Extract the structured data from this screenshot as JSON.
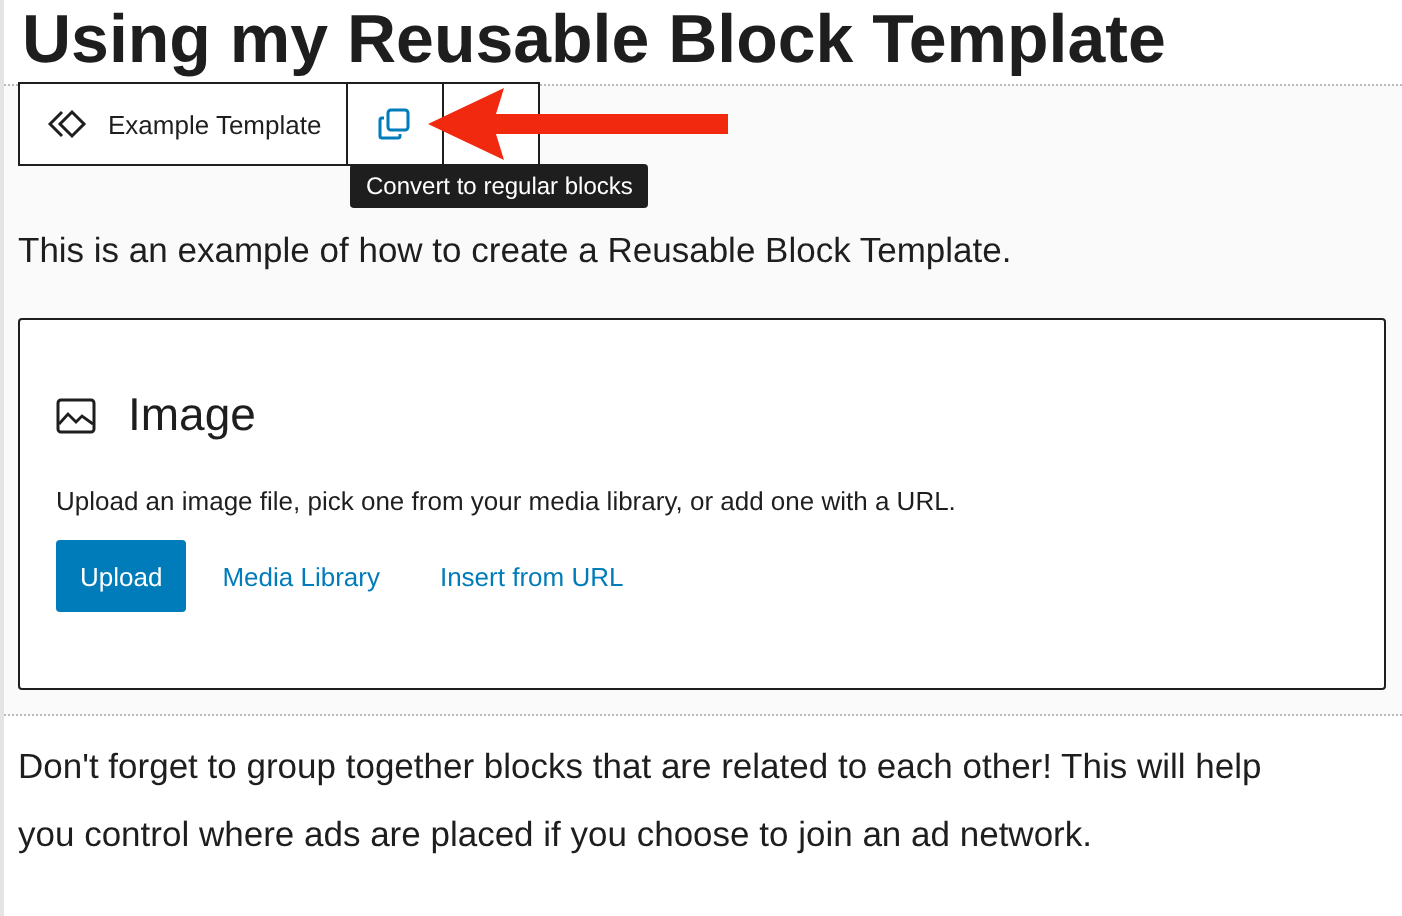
{
  "heading": "Using my Reusable Block Template",
  "toolbar": {
    "block_name": "Example Template",
    "convert_button": {
      "selected": false
    }
  },
  "tooltip": "Convert to regular blocks",
  "intro": "This is an example of how to create a Reusable Block Template.",
  "placeholder": {
    "title": "Image",
    "instructions": "Upload an image file, pick one from your media library, or add one with a URL.",
    "buttons": [
      {
        "label": "Upload",
        "kind": "primary"
      },
      {
        "label": "Media Library",
        "kind": "link"
      },
      {
        "label": "Insert from URL",
        "kind": "link"
      }
    ]
  },
  "paragraph": "Don't forget to group together blocks that are related to each other! This will help you control where ads are placed if you choose to join an ad network."
}
